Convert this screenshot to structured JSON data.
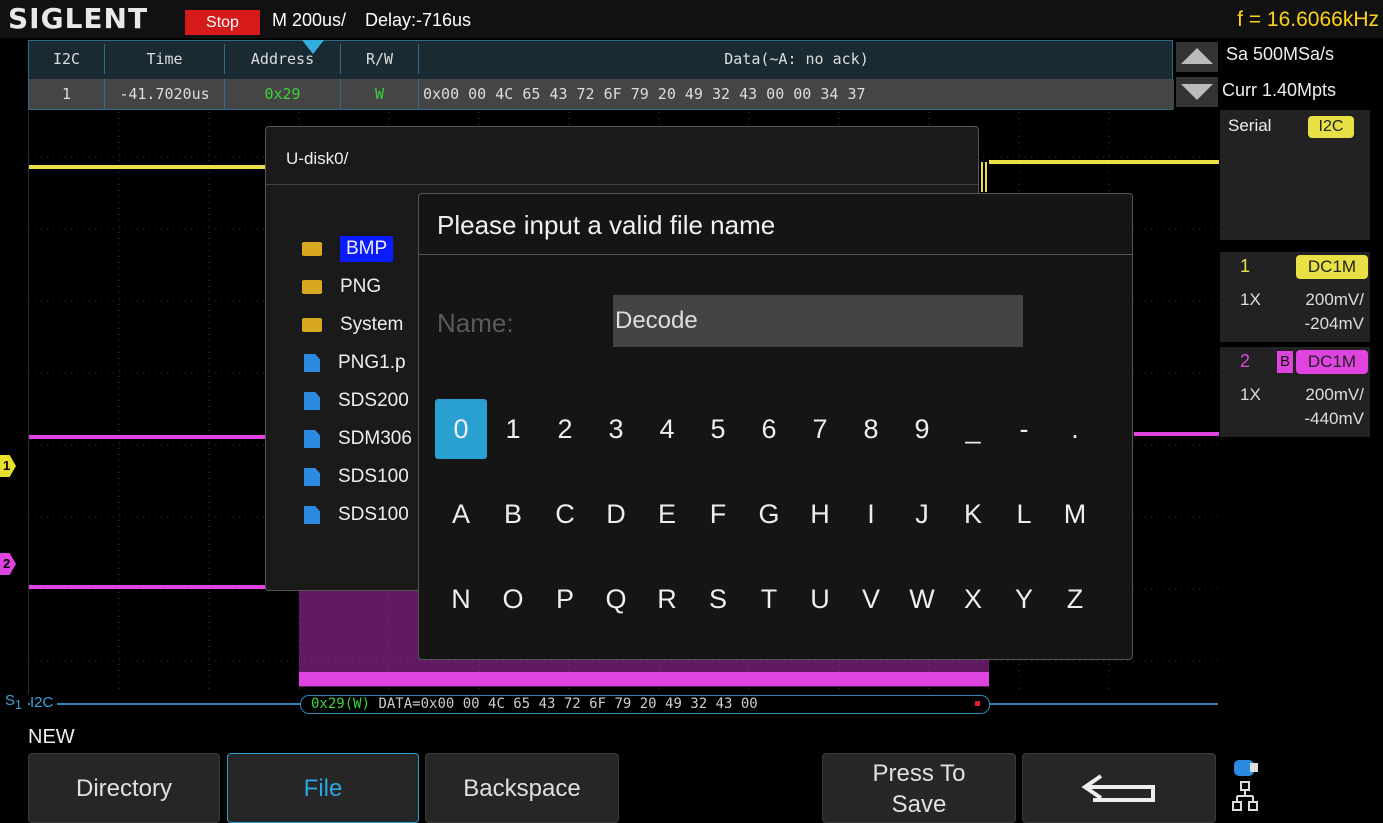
{
  "topbar": {
    "brand": "SIGLENT",
    "run_state": "Stop",
    "timebase": "M 200us/",
    "delay": "Delay:-716us",
    "frequency": "f = 16.6066kHz"
  },
  "decode_table": {
    "headers": [
      "I2C",
      "Time",
      "Address",
      "R/W",
      "Data(~A: no ack)"
    ],
    "row": {
      "index": "1",
      "time": "-41.7020us",
      "address": "0x29",
      "rw": "W",
      "data": "0x00 00 4C 65 43 72 6F 79 20 49 32 43 00 00 34 37"
    }
  },
  "acquisition": {
    "sample_rate": "Sa 500MSa/s",
    "memory": "Curr 1.40Mpts"
  },
  "serial": {
    "label": "Serial",
    "protocol": "I2C"
  },
  "channels": [
    {
      "num": "1",
      "coupling": "DC1M",
      "probe": "1X",
      "vdiv": "200mV/",
      "offset": "-204mV",
      "color": "#e8e045"
    },
    {
      "num": "2",
      "bw_flag": "B",
      "coupling": "DC1M",
      "probe": "1X",
      "vdiv": "200mV/",
      "offset": "-440mV",
      "color": "#e044e0"
    }
  ],
  "markers": {
    "ch1": "1",
    "ch2": "2"
  },
  "bus": {
    "source": "S",
    "source_sub": "1",
    "label": "I2C",
    "frame_addr": "0x29(W)",
    "frame_data": " DATA=0x00 00 4C 65 43 72 6F 79 20 49 32 43 00"
  },
  "file_browser": {
    "path": "U-disk0/",
    "items": [
      {
        "name": "BMP",
        "type": "folder",
        "selected": true
      },
      {
        "name": "PNG",
        "type": "folder"
      },
      {
        "name": "System",
        "type": "folder"
      },
      {
        "name": "PNG1.p",
        "type": "file"
      },
      {
        "name": "SDS200",
        "type": "file"
      },
      {
        "name": "SDM306",
        "type": "file"
      },
      {
        "name": "SDS100",
        "type": "file"
      },
      {
        "name": "SDS100",
        "type": "file"
      }
    ]
  },
  "dialog": {
    "title": "Please input a valid file name",
    "name_label": "Name:",
    "name_value": "Decode",
    "keyboard": {
      "row1": [
        "0",
        "1",
        "2",
        "3",
        "4",
        "5",
        "6",
        "7",
        "8",
        "9",
        "_",
        "-",
        "."
      ],
      "row2": [
        "A",
        "B",
        "C",
        "D",
        "E",
        "F",
        "G",
        "H",
        "I",
        "J",
        "K",
        "L",
        "M"
      ],
      "row3": [
        "N",
        "O",
        "P",
        "Q",
        "R",
        "S",
        "T",
        "U",
        "V",
        "W",
        "X",
        "Y",
        "Z"
      ],
      "active_key": "0"
    }
  },
  "status_text": "NEW",
  "softkeys": {
    "directory": "Directory",
    "file": "File",
    "backspace": "Backspace",
    "press_to_save_line1": "Press To",
    "press_to_save_line2": "Save"
  },
  "icons": {
    "return": "return-arrow-icon",
    "usb": "usb-icon",
    "network": "network-icon"
  },
  "colors": {
    "ch1": "#e8e045",
    "ch2": "#e044e0",
    "accent": "#2aa0d2",
    "stop": "#d61a1a",
    "frequency": "#ffd11a"
  }
}
